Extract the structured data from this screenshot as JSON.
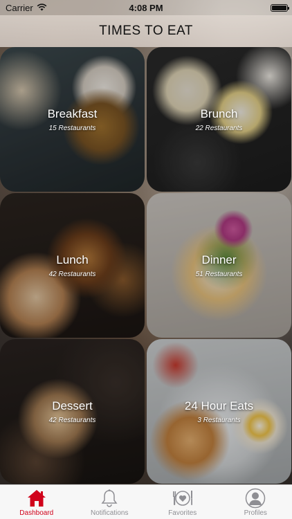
{
  "status_bar": {
    "carrier": "Carrier",
    "time": "4:08 PM",
    "battery_level": 1.0
  },
  "header": {
    "title": "TIMES TO EAT"
  },
  "tiles": [
    {
      "name": "Breakfast",
      "count": "15 Restaurants"
    },
    {
      "name": "Brunch",
      "count": "22 Restaurants"
    },
    {
      "name": "Lunch",
      "count": "42 Restaurants"
    },
    {
      "name": "Dinner",
      "count": "51 Restaurants"
    },
    {
      "name": "Dessert",
      "count": "42 Restaurants"
    },
    {
      "name": "24 Hour Eats",
      "count": "3 Restaurants"
    }
  ],
  "tabbar": {
    "accent": "#d0021b",
    "inactive": "#8e8e93",
    "tabs": [
      {
        "label": "Dashboard",
        "icon": "home-icon",
        "active": true
      },
      {
        "label": "Notifications",
        "icon": "bell-icon",
        "active": false
      },
      {
        "label": "Favorites",
        "icon": "heart-plate-icon",
        "active": false
      },
      {
        "label": "Profiles",
        "icon": "person-icon",
        "active": false
      }
    ]
  }
}
